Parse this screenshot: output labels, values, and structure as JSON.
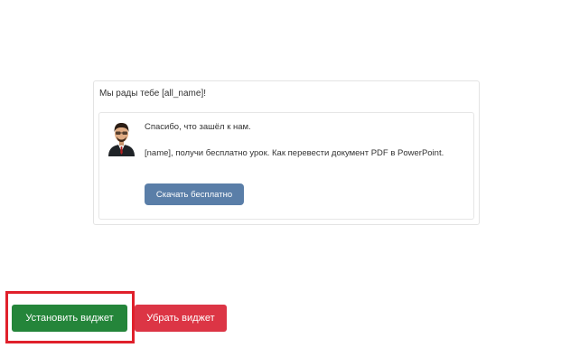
{
  "widget": {
    "greeting": "Мы рады тебе [all_name]!",
    "message": {
      "line1": "Спасибо, что зашёл к нам.",
      "line2": "[name], получи бесплатно урок. Как перевести документ PDF в PowerPoint.",
      "button_label": "Скачать бесплатно",
      "button_color": "#5a7ea8"
    },
    "avatar_icon": "person-avatar-icon"
  },
  "actions": {
    "install_label": "Установить виджет",
    "install_color": "#24853a",
    "remove_label": "Убрать виджет",
    "remove_color": "#dc3545",
    "highlight_color": "#e0202b"
  }
}
